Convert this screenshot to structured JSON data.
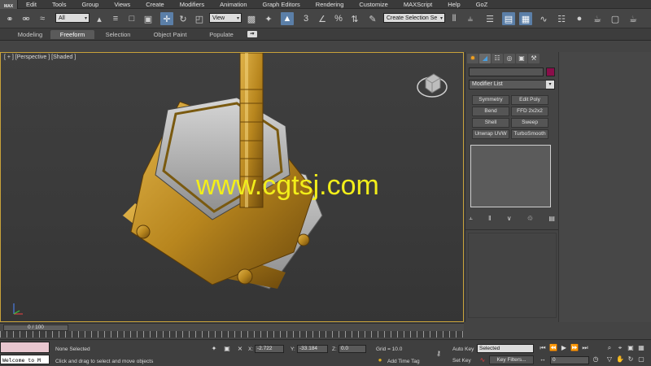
{
  "app": {
    "logo_text": "MAX"
  },
  "menu": [
    "Edit",
    "Tools",
    "Group",
    "Views",
    "Create",
    "Modifiers",
    "Animation",
    "Graph Editors",
    "Rendering",
    "Customize",
    "MAXScript",
    "Help",
    "GoZ"
  ],
  "toolbar": {
    "selection_filter": "All",
    "ref_coord": "View",
    "named_selection": "Create Selection Se",
    "snap_label": "3",
    "percent_snap": "%"
  },
  "ribbon": {
    "tabs": [
      "Modeling",
      "Freeform",
      "Selection",
      "Object Paint",
      "Populate"
    ],
    "active_tab": "Freeform",
    "extra_button": "▪▾"
  },
  "viewport": {
    "label": "[ + ] [Perspective ] [Shaded ]",
    "watermark": "www.cgtsj.com"
  },
  "command_panel": {
    "name_value": "",
    "object_color": "#8a0e4a",
    "modifier_list_label": "Modifier List",
    "modifier_buttons": [
      "Symmetry",
      "Edit Poly",
      "Bend",
      "FFD 2x2x2",
      "Shell",
      "Sweep",
      "Unwrap UVW",
      "TurboSmooth"
    ]
  },
  "timeslider": {
    "frame_label": "0 / 100"
  },
  "statusbar": {
    "selection_status": "None Selected",
    "prompt": "Click and drag to select and move objects",
    "x_label": "X:",
    "x_value": "-2.722",
    "y_label": "Y:",
    "y_value": "-33.184",
    "z_label": "Z:",
    "z_value": "0.0",
    "grid": "Grid = 10.0",
    "add_time_tag": "Add Time Tag",
    "auto_key": "Auto Key",
    "set_key": "Set Key",
    "key_mode": "Selected",
    "key_filters": "Key Filters...",
    "current_frame": "0",
    "maxscript_output": "Welcome to M"
  }
}
